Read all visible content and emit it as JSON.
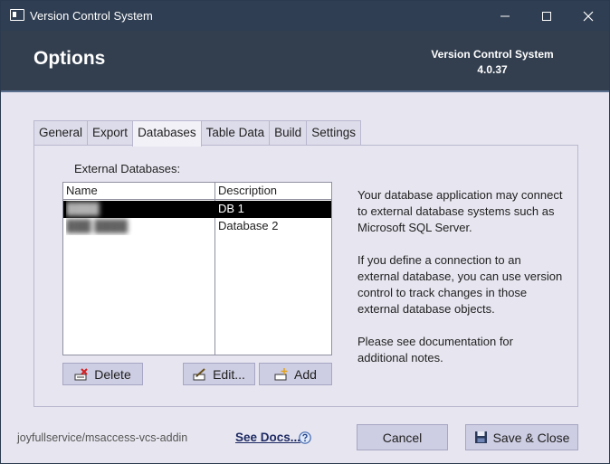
{
  "window": {
    "title": "Version Control System",
    "controls": {
      "minimize_icon": "minimize-icon",
      "maximize_icon": "maximize-icon",
      "close_icon": "close-icon"
    }
  },
  "header": {
    "heading": "Options",
    "product": "Version Control System",
    "version": "4.0.37"
  },
  "tabs": [
    {
      "label": "General",
      "active": false
    },
    {
      "label": "Export",
      "active": false
    },
    {
      "label": "Databases",
      "active": true
    },
    {
      "label": "Table Data",
      "active": false
    },
    {
      "label": "Build",
      "active": false
    },
    {
      "label": "Settings",
      "active": false
    }
  ],
  "databases": {
    "label": "External Databases:",
    "columns": [
      "Name",
      "Description"
    ],
    "rows": [
      {
        "name": "████",
        "description": "DB 1",
        "selected": true
      },
      {
        "name": "███ ████",
        "description": "Database 2",
        "selected": false
      }
    ],
    "buttons": {
      "delete": "Delete",
      "edit": "Edit...",
      "add": "Add"
    }
  },
  "help_text": [
    "Your database application may connect to external database systems such as Microsoft SQL Server.",
    "If you define a connection to an external database, you can use version control to track changes in those external database objects.",
    "Please see documentation for additional notes."
  ],
  "footer": {
    "repo": "joyfullservice/msaccess-vcs-addin",
    "see_docs": "See Docs...",
    "cancel": "Cancel",
    "save_close": "Save & Close"
  },
  "colors": {
    "titlebar": "#2f3e52",
    "header": "#333f4f",
    "body": "#e7e6f0",
    "button": "#cdcde3",
    "link": "#1e2a63"
  }
}
